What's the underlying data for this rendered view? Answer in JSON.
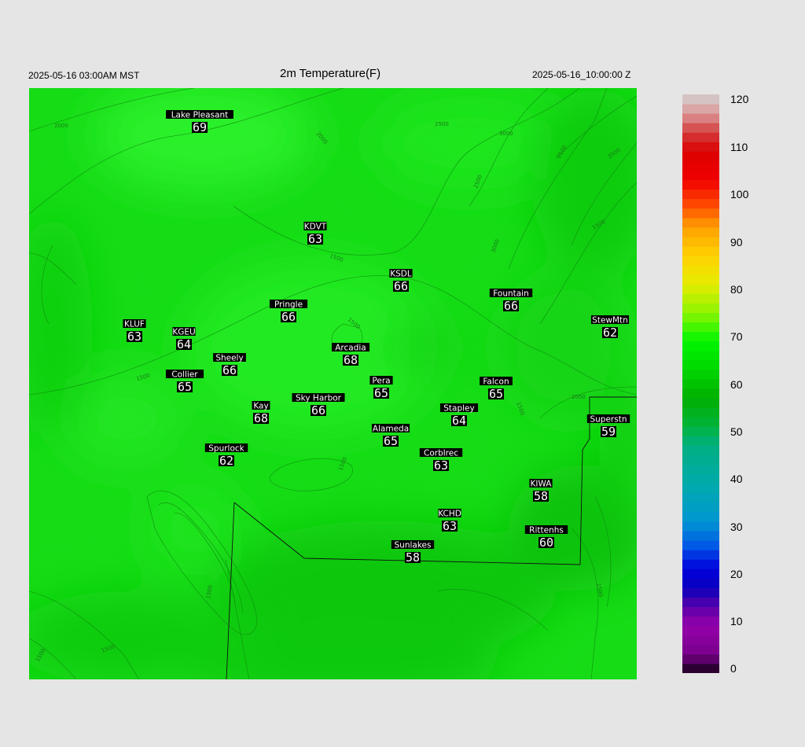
{
  "header": {
    "local_time": "2025-05-16 03:00AM MST",
    "title": "2m Temperature(F)",
    "valid_time": "2025-05-16_10:00:00 Z"
  },
  "colorbar": {
    "ticks": [
      "120",
      "110",
      "100",
      "90",
      "80",
      "70",
      "60",
      "50",
      "40",
      "30",
      "20",
      "10",
      "0"
    ]
  },
  "stations": [
    {
      "name": "Lake Pleasant",
      "temp": "69"
    },
    {
      "name": "KDVT",
      "temp": "63"
    },
    {
      "name": "KSDL",
      "temp": "66"
    },
    {
      "name": "Fountain",
      "temp": "66"
    },
    {
      "name": "Pringle",
      "temp": "66"
    },
    {
      "name": "StewMtn",
      "temp": "62"
    },
    {
      "name": "KLUF",
      "temp": "63"
    },
    {
      "name": "KGEU",
      "temp": "64"
    },
    {
      "name": "Arcadia",
      "temp": "68"
    },
    {
      "name": "Sheely",
      "temp": "66"
    },
    {
      "name": "Collier",
      "temp": "65"
    },
    {
      "name": "Pera",
      "temp": "65"
    },
    {
      "name": "Falcon",
      "temp": "65"
    },
    {
      "name": "Kay",
      "temp": "68"
    },
    {
      "name": "Sky Harbor",
      "temp": "66"
    },
    {
      "name": "Stapley",
      "temp": "64"
    },
    {
      "name": "Superstn",
      "temp": "59"
    },
    {
      "name": "Alameda",
      "temp": "65"
    },
    {
      "name": "Spurlock",
      "temp": "62"
    },
    {
      "name": "Corblrec",
      "temp": "63"
    },
    {
      "name": "KIWA",
      "temp": "58"
    },
    {
      "name": "KCHD",
      "temp": "63"
    },
    {
      "name": "Rittenhs",
      "temp": "60"
    },
    {
      "name": "Sunlakes",
      "temp": "58"
    }
  ],
  "contour_labels": [
    "2000",
    "2000",
    "2500",
    "3000",
    "3500",
    "2500",
    "2500",
    "3000",
    "1500",
    "1500",
    "1500",
    "1500",
    "1500",
    "1500",
    "1500",
    "1500",
    "1500",
    "2000",
    "1500"
  ]
}
